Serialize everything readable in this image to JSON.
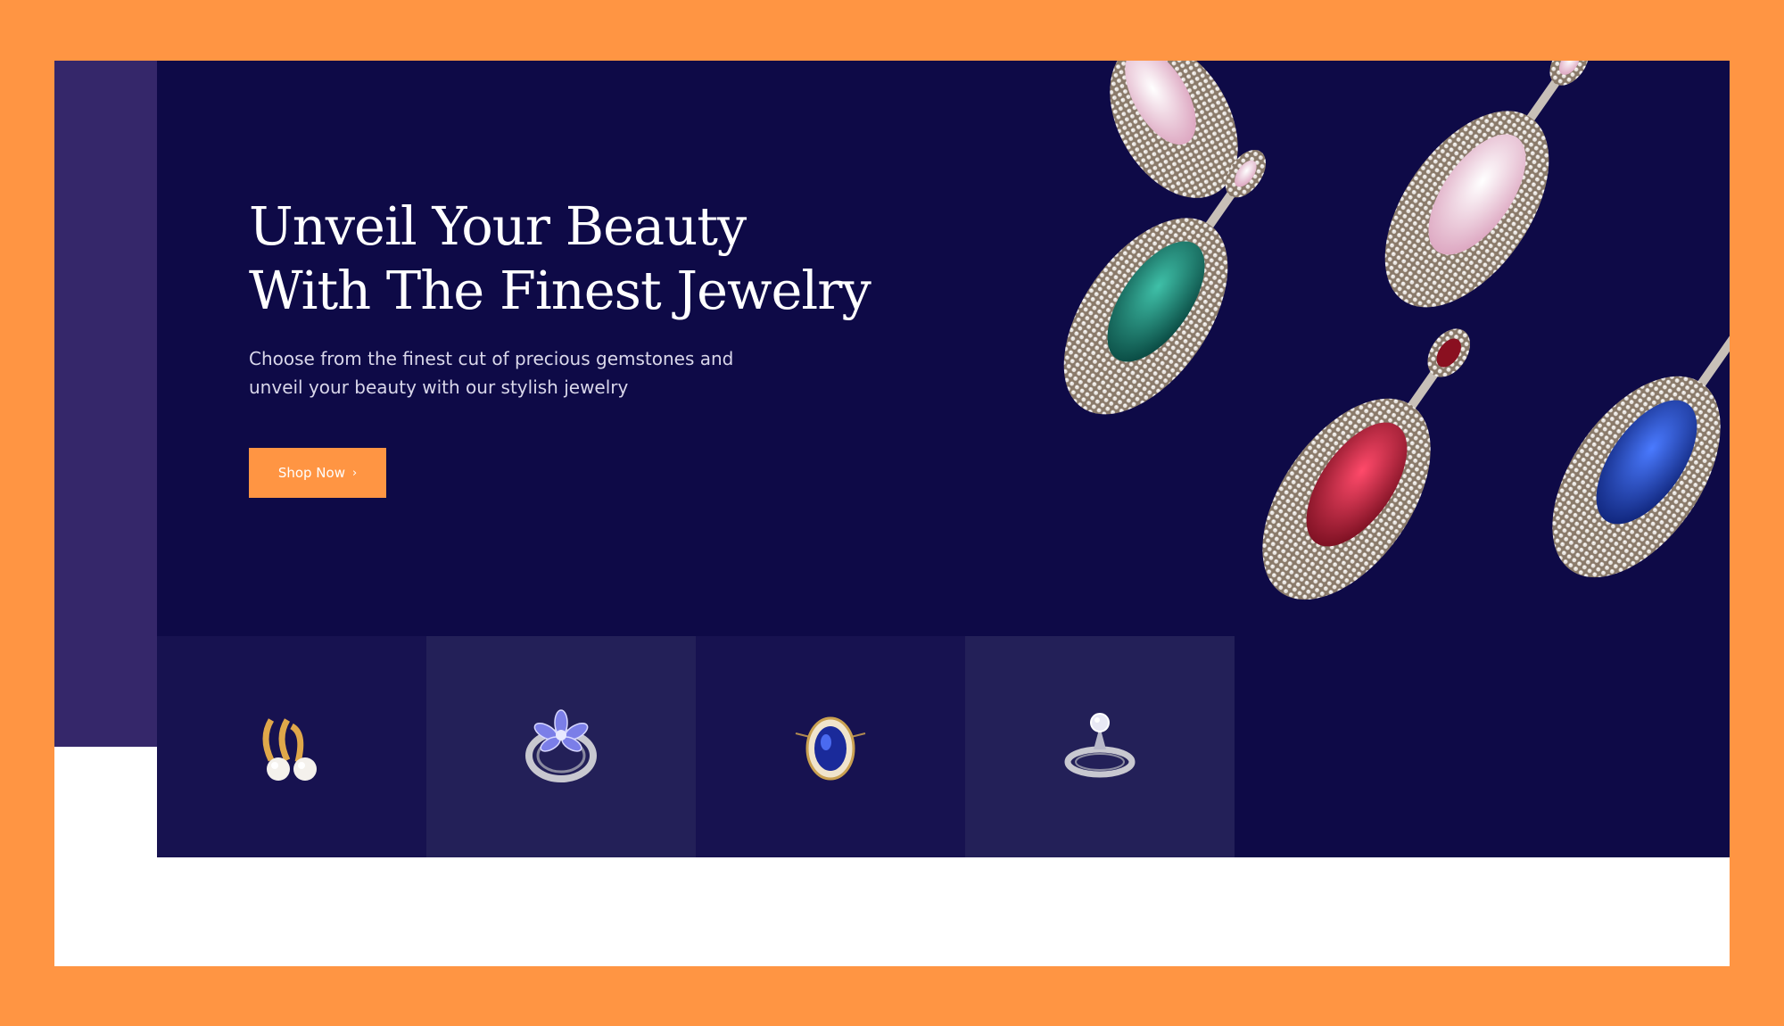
{
  "hero": {
    "title": "Unveil Your Beauty\nWith The Finest Jewelry",
    "subtitle": "Choose from the finest cut of precious gemstones and unveil your beauty with our stylish jewelry",
    "button_label": "Shop Now",
    "button_icon": "chevron-right-icon"
  },
  "categories": [
    {
      "icon": "pearl-earrings-icon"
    },
    {
      "icon": "flower-ring-icon"
    },
    {
      "icon": "sapphire-pendant-icon"
    },
    {
      "icon": "solitaire-ring-icon"
    }
  ],
  "colors": {
    "frame": "#FF9543",
    "hero_bg": "#0E0A47",
    "left_strip": "#35276A",
    "accent": "#FF9543",
    "tile_dark": "#171250",
    "tile_light": "#232058"
  }
}
